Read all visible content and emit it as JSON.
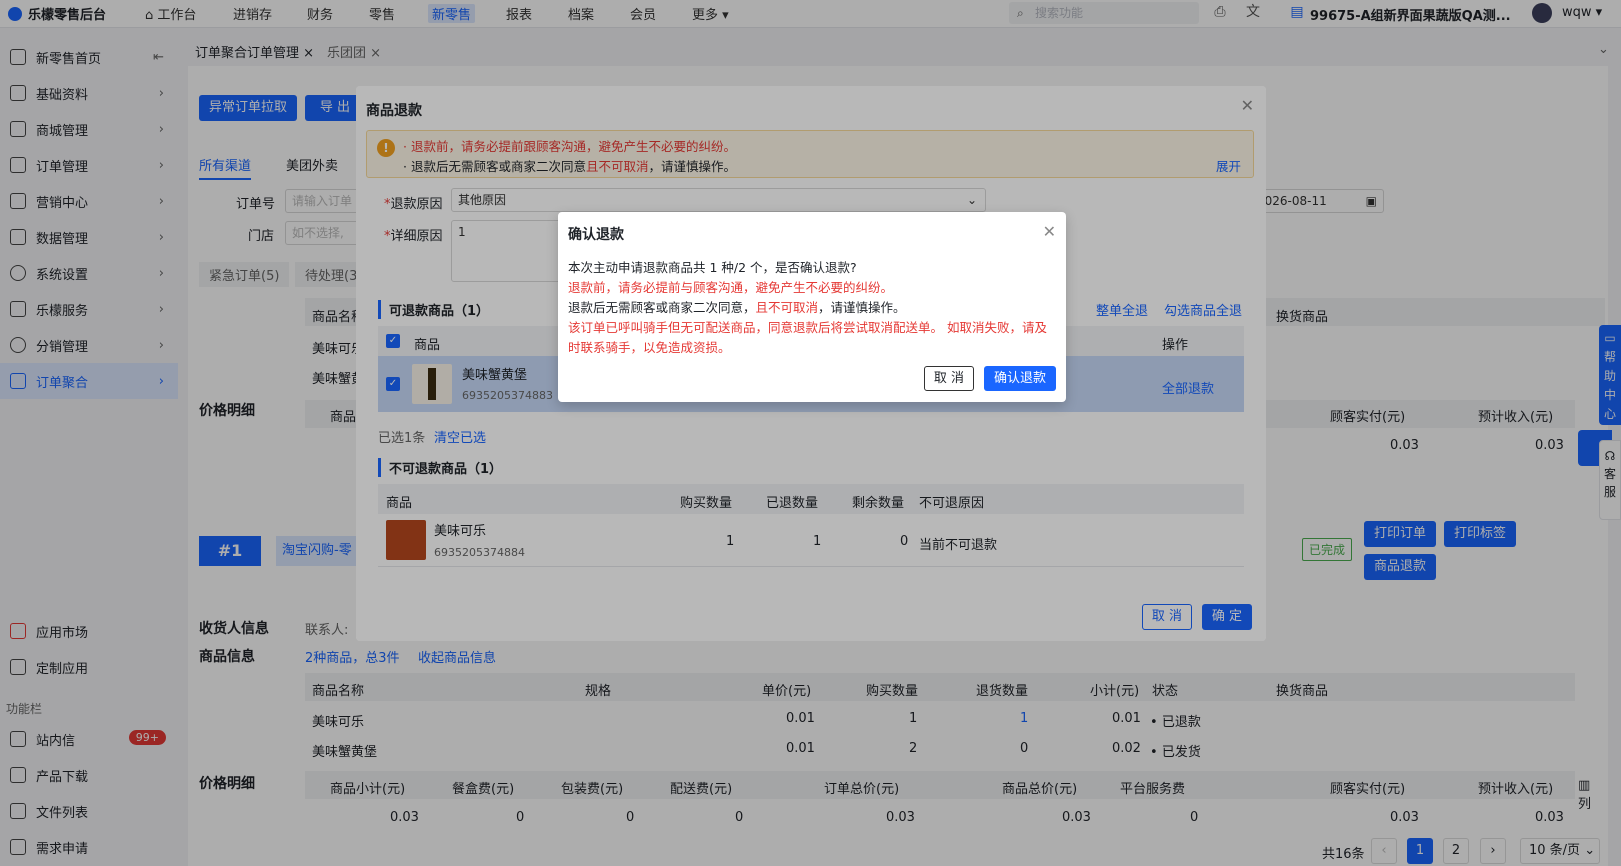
{
  "topbar": {
    "logo": "乐檬零售后台",
    "nav": [
      "工作台",
      "进销存",
      "财务",
      "零售",
      "新零售",
      "报表",
      "档案",
      "会员",
      "更多"
    ],
    "active_nav": "新零售",
    "search_placeholder": "搜索功能",
    "store": "99675-A组新界面果蔬版QA测...",
    "user": "wqw"
  },
  "sidebar": {
    "items": [
      {
        "label": "新零售首页"
      },
      {
        "label": "基础资料"
      },
      {
        "label": "商城管理"
      },
      {
        "label": "订单管理"
      },
      {
        "label": "营销中心"
      },
      {
        "label": "数据管理"
      },
      {
        "label": "系统设置"
      },
      {
        "label": "乐檬服务"
      },
      {
        "label": "分销管理"
      },
      {
        "label": "订单聚合"
      }
    ],
    "bottom": [
      {
        "label": "应用市场"
      },
      {
        "label": "定制应用"
      }
    ],
    "section": "功能栏",
    "tools": [
      {
        "label": "站内信",
        "badge": "99+"
      },
      {
        "label": "产品下载"
      },
      {
        "label": "文件列表"
      },
      {
        "label": "需求申请"
      }
    ]
  },
  "tabs": [
    "订单聚合订单管理",
    "乐团团"
  ],
  "main": {
    "btn_abnormal": "异常订单拉取",
    "btn_export": "导 出",
    "channels": [
      "所有渠道",
      "美团外卖"
    ],
    "order_no_label": "订单号",
    "order_no_placeholder": "请输入订单",
    "store_label": "门店",
    "store_placeholder": "如不选择,",
    "date_value": "2026-08-11",
    "status_tabs": [
      "紧急订单(5)",
      "待处理(3)"
    ],
    "bg_col1": "商品名称",
    "bg_row1": "美味可乐",
    "bg_row2": "美味蟹黄",
    "price_detail": "价格明细",
    "bg_price_col": "商品",
    "right_col_swap": "换货商品",
    "right_col_paid": "顾客实付(元)",
    "right_col_income": "预计收入(元)",
    "right_val_paid": "0.03",
    "right_val_income": "0.03",
    "order_no_badge": "#1",
    "order_channel": "淘宝闪购-零",
    "status_done": "已完成",
    "btn_print_order": "打印订单",
    "btn_print_label": "打印标签",
    "btn_refund": "商品退款",
    "receiver_label": "收货人信息",
    "contact_label": "联系人:",
    "goods_info_label": "商品信息",
    "goods_summary": "2种商品，总3件",
    "collapse_link": "收起商品信息",
    "goods_table": {
      "headers": [
        "商品名称",
        "规格",
        "单价(元)",
        "购买数量",
        "退货数量",
        "小计(元)",
        "状态",
        "换货商品"
      ],
      "rows": [
        [
          "美味可乐",
          "",
          "0.01",
          "1",
          "1",
          "0.01",
          "已退款",
          ""
        ],
        [
          "美味蟹黄堡",
          "",
          "0.01",
          "2",
          "0",
          "0.02",
          "已发货",
          ""
        ]
      ]
    },
    "price_table": {
      "headers": [
        "商品小计(元)",
        "餐盒费(元)",
        "包装费(元)",
        "配送费(元)",
        "订单总价(元)",
        "商品总价(元)",
        "平台服务费",
        "顾客实付(元)",
        "预计收入(元)"
      ],
      "values": [
        "0.03",
        "0",
        "0",
        "0",
        "0.03",
        "0.03",
        "0",
        "0.03",
        "0.03"
      ]
    },
    "col_toggle": "列",
    "pagination": {
      "total": "共16条",
      "pages": [
        "1",
        "2"
      ],
      "size": "10 条/页"
    }
  },
  "refund_dialog": {
    "title": "商品退款",
    "warn_line1": "· 退款前，请务必提前跟顾客沟通，避免产生不必要的纠纷。",
    "warn_line2_a": "· 退款后无需顾客或商家二次同意",
    "warn_line2_b": "且不可取消",
    "warn_line2_c": "，请谨慎操作。",
    "expand": "展开",
    "reason_label": "退款原因",
    "reason_value": "其他原因",
    "detail_label": "详细原因",
    "detail_value": "1",
    "refundable_title": "可退款商品（1）",
    "link_all": "整单全退",
    "link_checked": "勾选商品全退",
    "col_goods": "商品",
    "col_op": "操作",
    "item_name": "美味蟹黄堡",
    "item_code": "6935205374883",
    "item_op": "全部退款",
    "selected": "已选1条",
    "clear": "清空已选",
    "nonrefund_title": "不可退款商品（1）",
    "nr_headers": [
      "商品",
      "购买数量",
      "已退数量",
      "剩余数量",
      "不可退原因"
    ],
    "nr_item": {
      "name": "美味可乐",
      "code": "6935205374884",
      "bought": "1",
      "refunded": "1",
      "remain": "0",
      "reason": "当前不可退款"
    },
    "cancel": "取 消",
    "ok": "确 定"
  },
  "confirm_dialog": {
    "title": "确认退款",
    "line1": "本次主动申请退款商品共 1 种/2 个，是否确认退款?",
    "line2": "退款前，请务必提前与顾客沟通，避免产生不必要的纠纷。",
    "line3_a": "退款后无需顾客或商家二次同意，",
    "line3_b": "且不可取消",
    "line3_c": "，请谨慎操作。",
    "line4": "该订单已呼叫骑手但无可配送商品，同意退款后将尝试取消配送单。 如取消失败，请及",
    "line5": "时联系骑手，以免造成资损。",
    "cancel": "取 消",
    "ok": "确认退款"
  },
  "floats": {
    "help": "帮助中心",
    "service": "客服"
  },
  "colors": {
    "primary": "#1a66ff",
    "danger": "#e53935",
    "warning": "#f0a020",
    "success": "#4caf50"
  }
}
